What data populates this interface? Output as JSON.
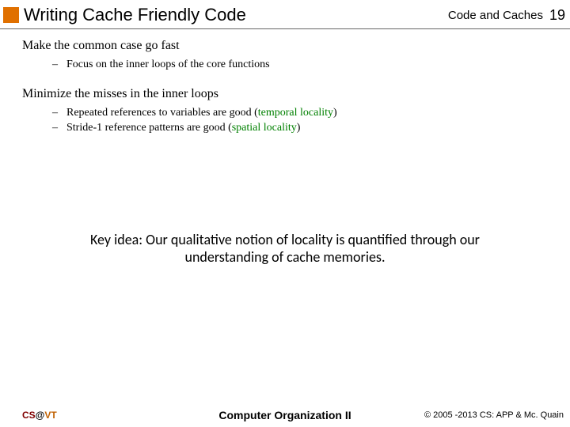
{
  "header": {
    "title": "Writing Cache Friendly Code",
    "chapter": "Code and Caches",
    "page": "19"
  },
  "section1": {
    "heading": "Make the common case go fast",
    "items": [
      "Focus on the inner loops of the core functions"
    ]
  },
  "section2": {
    "heading": "Minimize the misses in the inner loops",
    "items": [
      {
        "pre": "Repeated references to variables are good (",
        "em": "temporal locality",
        "post": ")"
      },
      {
        "pre": "Stride-1 reference patterns are good (",
        "em": "spatial locality",
        "post": ")"
      }
    ]
  },
  "keyidea": "Key idea: Our qualitative notion of locality is quantified through our understanding of cache memories.",
  "footer": {
    "cs": "CS",
    "at": "@",
    "vt": "VT",
    "center": "Computer Organization II",
    "right": "© 2005 -2013 CS: APP & Mc. Quain"
  }
}
